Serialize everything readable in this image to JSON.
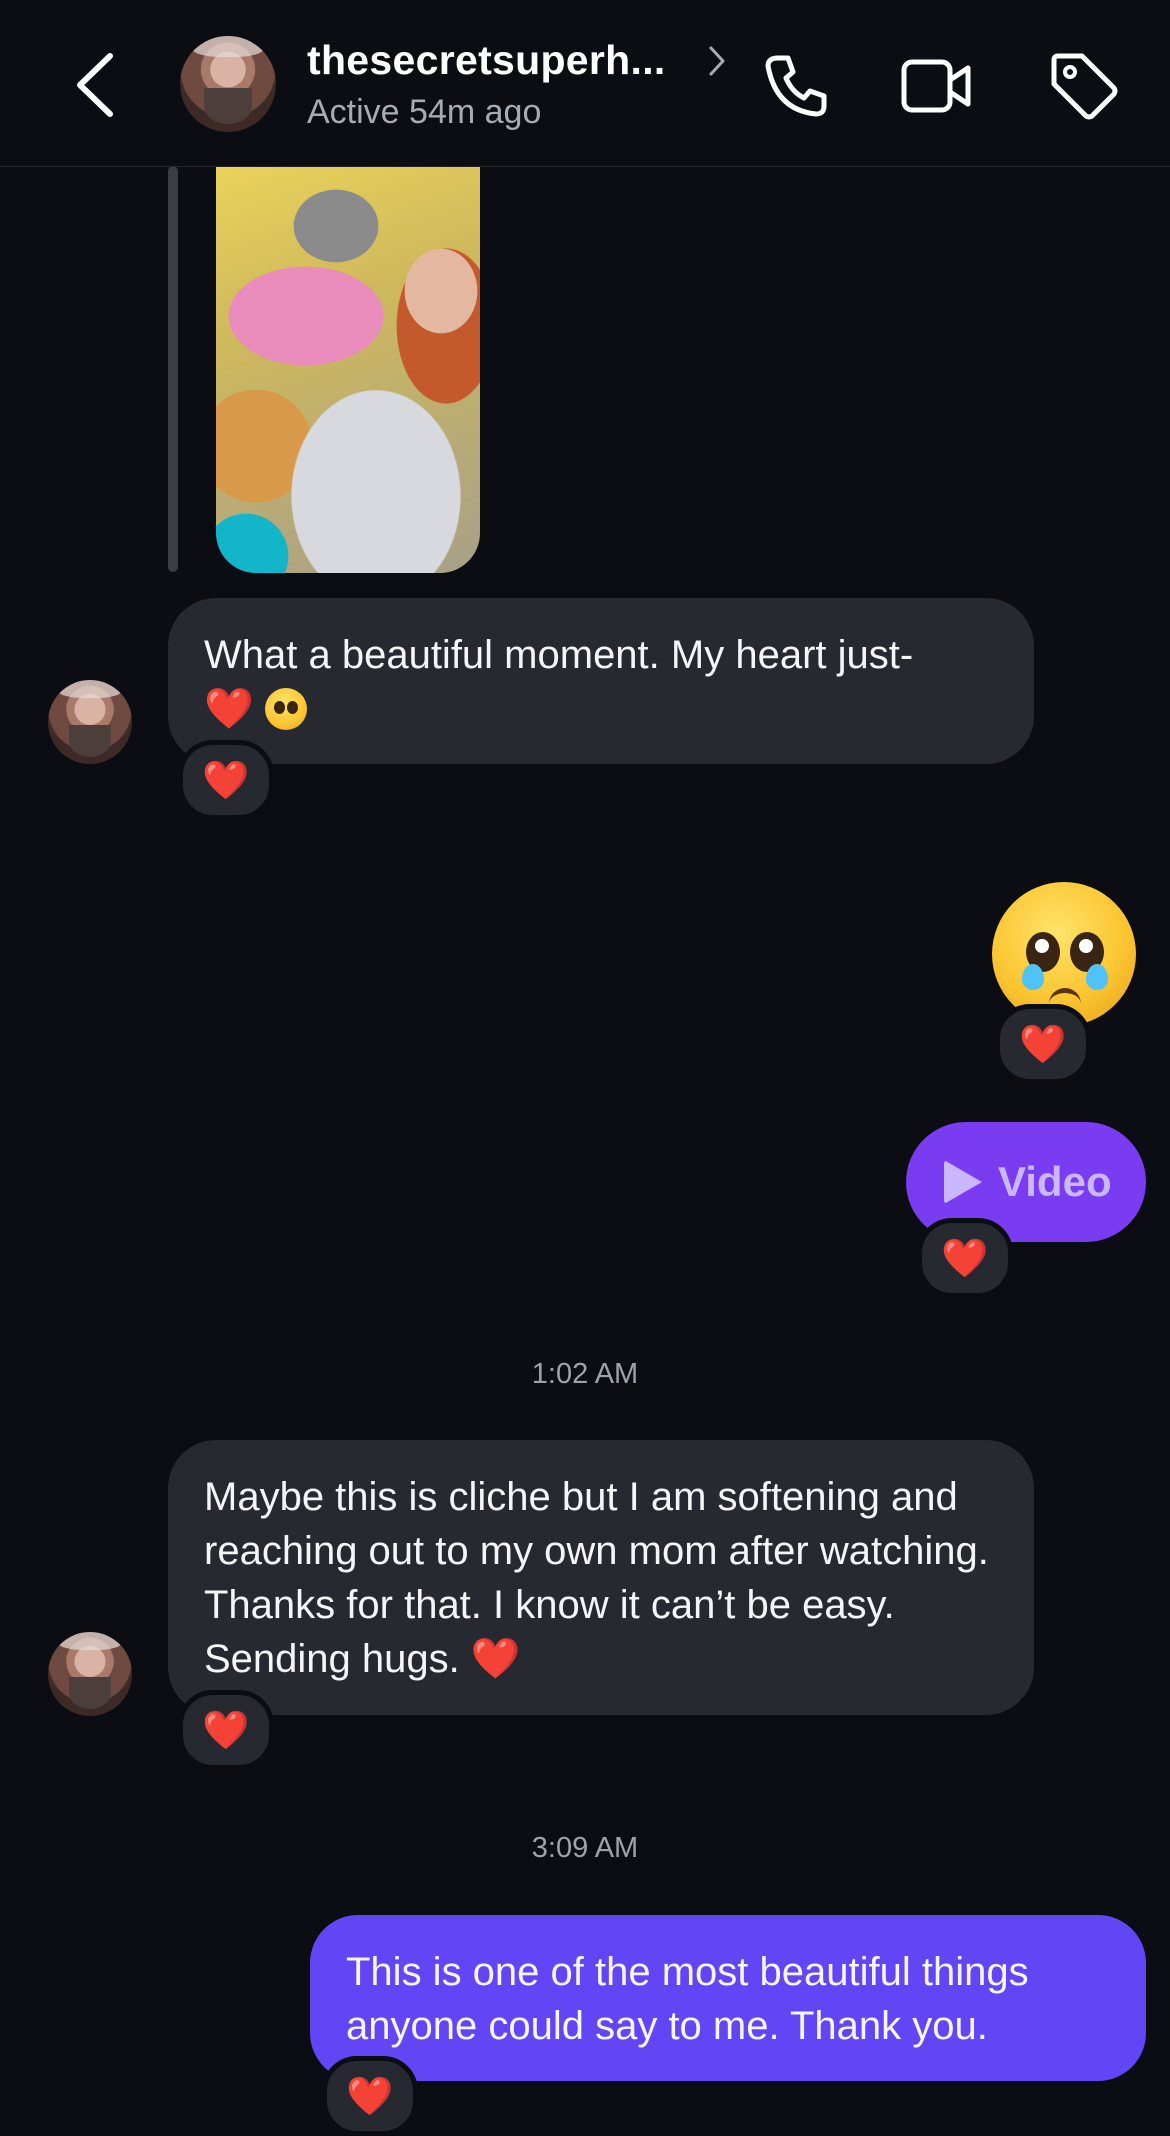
{
  "header": {
    "username": "thesecretsuperh...",
    "status": "Active 54m ago",
    "icons": [
      "back-arrow-icon",
      "chevron-right-icon",
      "phone-icon",
      "video-camera-icon",
      "tag-icon"
    ]
  },
  "messages": [
    {
      "id": "m1",
      "direction": "incoming",
      "type": "text",
      "text": "What a beautiful moment. My heart just-",
      "emojis": [
        "❤️",
        "🥹"
      ],
      "reaction": "❤️"
    },
    {
      "id": "m2",
      "direction": "outgoing",
      "type": "emoji",
      "emoji": "🥹",
      "reaction": "❤️"
    },
    {
      "id": "m3",
      "direction": "outgoing",
      "type": "video",
      "label": "Video",
      "reaction": "❤️"
    },
    {
      "id": "m4",
      "direction": "incoming",
      "type": "text",
      "timestamp": "1:02 AM",
      "text": "Maybe this is cliche but I am softening and reaching out to my own mom after watching. Thanks for that. I know it can’t be easy. Sending hugs.",
      "emojis": [
        "❤️"
      ],
      "reaction": "❤️"
    },
    {
      "id": "m5",
      "direction": "outgoing",
      "type": "text",
      "timestamp": "3:09 AM",
      "text": "This is one of the most beautiful things anyone could say to me. Thank you.",
      "reaction": "❤️"
    }
  ],
  "colors": {
    "background": "#0b0d12",
    "incoming_bubble": "#262930",
    "outgoing_bubble": "#6245f5",
    "video_bubble": "#7a3cf0",
    "heart": "#e8283b"
  }
}
